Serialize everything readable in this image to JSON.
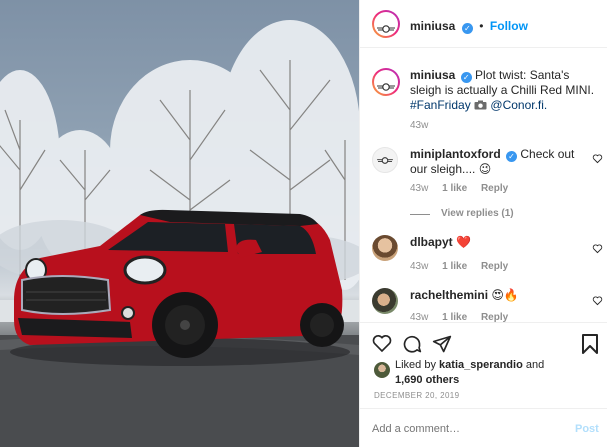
{
  "header": {
    "username": "miniusa",
    "verified_icon": "verified-badge-icon",
    "separator": "•",
    "follow_label": "Follow"
  },
  "caption": {
    "username": "miniusa",
    "text": "Plot twist: Santa's sleigh is actually a Chilli Red MINI.",
    "hashtag": "#FanFriday",
    "camera_icon": "camera-icon",
    "mention": "@Conor.fi.",
    "time": "43w"
  },
  "comments": [
    {
      "username": "miniplantoxford",
      "text": "Check out our sleigh.... 😉",
      "time": "43w",
      "likes": "1 like",
      "reply": "Reply",
      "view_replies": "View replies (1)"
    },
    {
      "username": "dlbapyt",
      "text": "❤️",
      "time": "43w",
      "likes": "1 like",
      "reply": "Reply"
    },
    {
      "username": "rachelthemini",
      "text": "😍🔥",
      "time": "43w",
      "likes": "1 like",
      "reply": "Reply"
    }
  ],
  "likes": {
    "prefix": "Liked by",
    "user": "katia_sperandio",
    "and": "and",
    "count": "1,690 others"
  },
  "date": "DECEMBER 20, 2019",
  "add_comment": {
    "placeholder": "Add a comment…",
    "post_label": "Post"
  },
  "colors": {
    "accent": "#0095f6",
    "car_red": "#b8101d",
    "heart": "#ed4956"
  }
}
